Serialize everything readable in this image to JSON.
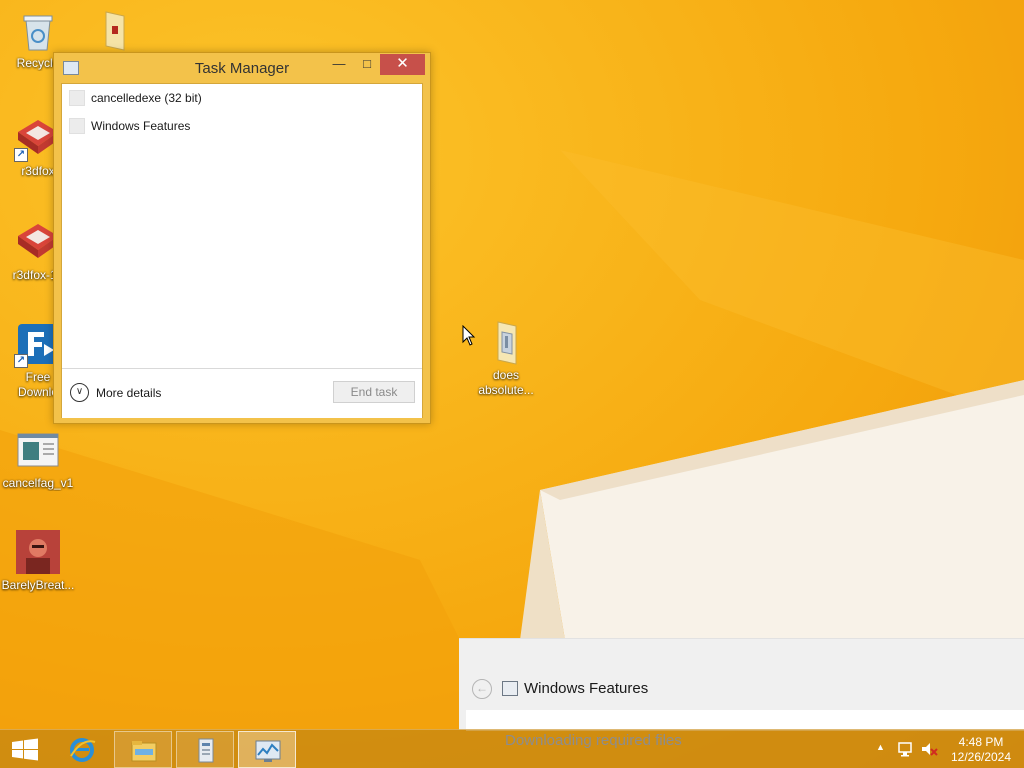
{
  "desktop": {
    "icons": [
      {
        "label": "Recycle",
        "icon": "recycle-bin-icon"
      },
      {
        "label": "",
        "icon": "folder-icon"
      },
      {
        "label": "r3dfox",
        "icon": "r3dfox-icon"
      },
      {
        "label": "r3dfox-13",
        "icon": "r3dfox-icon"
      },
      {
        "label": "Free Downlo",
        "icon": "free-download-manager-icon"
      },
      {
        "label": "cancelfag_v1",
        "icon": "document-window-icon"
      },
      {
        "label": "BarelyBreat...",
        "icon": "image-thumbnail-icon"
      },
      {
        "label": "does absolute...",
        "icon": "folder-icon"
      }
    ]
  },
  "task_manager": {
    "title": "Task Manager",
    "minimize_glyph": "—",
    "maximize_glyph": "□",
    "close_glyph": "✕",
    "processes": [
      {
        "label": "cancelledexe (32 bit)"
      },
      {
        "label": "Windows Features"
      }
    ],
    "more_details_label": "More details",
    "end_task_label": "End task"
  },
  "windows_features": {
    "title": "Windows Features",
    "status": "Downloading required files"
  },
  "taskbar": {
    "apps": [
      "internet-explorer-icon",
      "file-explorer-icon",
      "installer-icon",
      "task-manager-icon"
    ],
    "clock_time": "4:48 PM",
    "clock_date": "12/26/2024"
  },
  "colors": {
    "wallpaper": "#f7ab12",
    "taskbar": "#c78812",
    "close_button": "#c7504a"
  }
}
